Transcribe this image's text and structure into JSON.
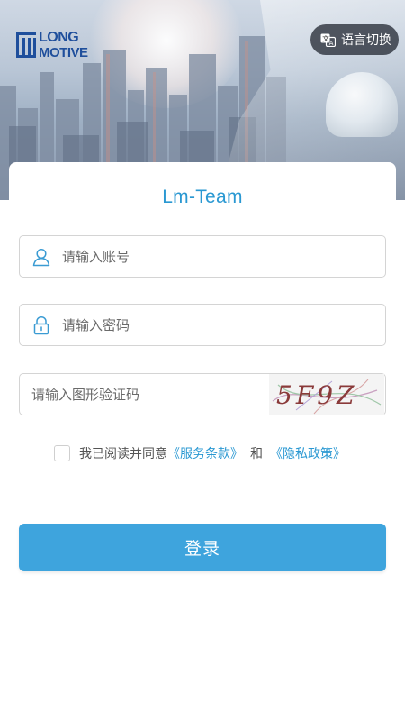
{
  "header": {
    "logo_line1": "LONG",
    "logo_line2": "MOTIVE",
    "language_button": "语言切换",
    "language_icon": "translate-icon"
  },
  "login": {
    "title": "Lm-Team",
    "account": {
      "placeholder": "请输入账号",
      "icon": "user-icon"
    },
    "password": {
      "placeholder": "请输入密码",
      "icon": "lock-icon"
    },
    "captcha": {
      "placeholder": "请输入图形验证码",
      "code": "5F9Z"
    },
    "agreement": {
      "prefix": "我已阅读并同意",
      "terms_link": "《服务条款》",
      "connector": "和",
      "privacy_link": "《隐私政策》",
      "checked": false
    },
    "submit_label": "登录"
  },
  "colors": {
    "accent": "#2a98d2",
    "button": "#3ea4dd",
    "brand": "#1f4f9c"
  }
}
